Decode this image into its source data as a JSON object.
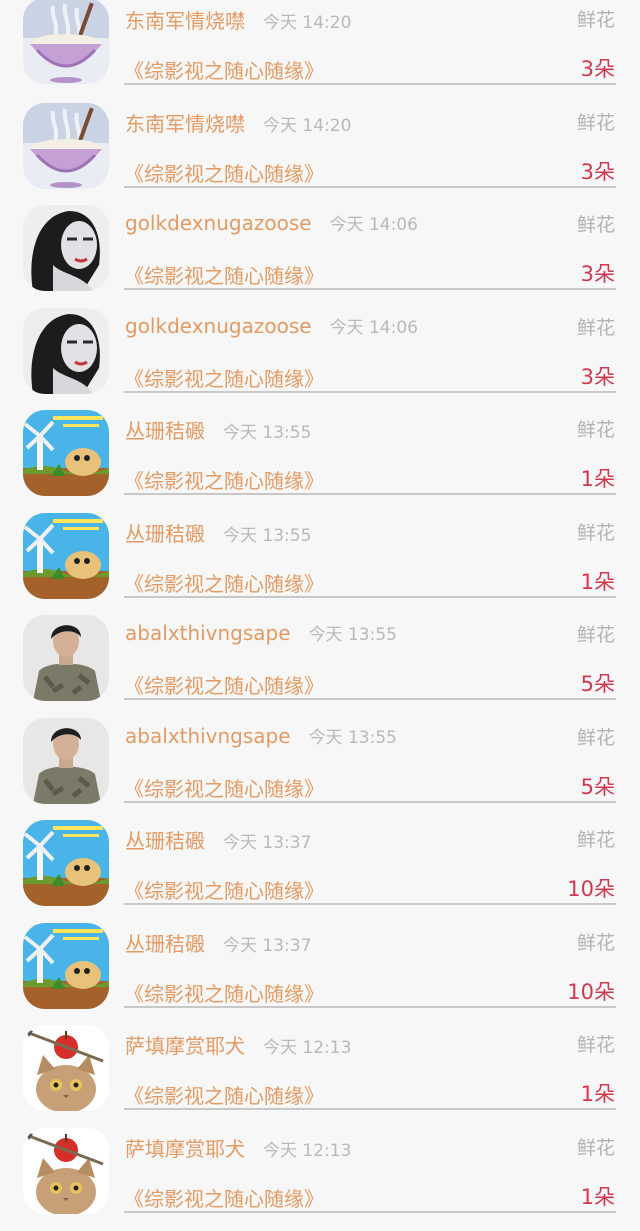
{
  "gifts": [
    {
      "user": "东南军情烧噤",
      "time": "今天 14:20",
      "gift": "鲜花",
      "book": "《综影视之随心随缘》",
      "count": "3朵",
      "avatar": "noodle-bowl"
    },
    {
      "user": "东南军情烧噤",
      "time": "今天 14:20",
      "gift": "鲜花",
      "book": "《综影视之随心随缘》",
      "count": "3朵",
      "avatar": "noodle-bowl"
    },
    {
      "user": "golkdexnugazoose",
      "time": "今天 14:06",
      "gift": "鲜花",
      "book": "《综影视之随心随缘》",
      "count": "3朵",
      "avatar": "woman-portrait"
    },
    {
      "user": "golkdexnugazoose",
      "time": "今天 14:06",
      "gift": "鲜花",
      "book": "《综影视之随心随缘》",
      "count": "3朵",
      "avatar": "woman-portrait"
    },
    {
      "user": "丛珊秸磤",
      "time": "今天 13:55",
      "gift": "鲜花",
      "book": "《综影视之随心随缘》",
      "count": "1朵",
      "avatar": "cartoon-field"
    },
    {
      "user": "丛珊秸磤",
      "time": "今天 13:55",
      "gift": "鲜花",
      "book": "《综影视之随心随缘》",
      "count": "1朵",
      "avatar": "cartoon-field"
    },
    {
      "user": "abalxthivngsape",
      "time": "今天 13:55",
      "gift": "鲜花",
      "book": "《综影视之随心随缘》",
      "count": "5朵",
      "avatar": "man-portrait"
    },
    {
      "user": "abalxthivngsape",
      "time": "今天 13:55",
      "gift": "鲜花",
      "book": "《综影视之随心随缘》",
      "count": "5朵",
      "avatar": "man-portrait"
    },
    {
      "user": "丛珊秸磤",
      "time": "今天 13:37",
      "gift": "鲜花",
      "book": "《综影视之随心随缘》",
      "count": "10朵",
      "avatar": "cartoon-field"
    },
    {
      "user": "丛珊秸磤",
      "time": "今天 13:37",
      "gift": "鲜花",
      "book": "《综影视之随心随缘》",
      "count": "10朵",
      "avatar": "cartoon-field"
    },
    {
      "user": "萨填摩赏耶犬",
      "time": "今天 12:13",
      "gift": "鲜花",
      "book": "《综影视之随心随缘》",
      "count": "1朵",
      "avatar": "cat-apple"
    },
    {
      "user": "萨填摩赏耶犬",
      "time": "今天 12:13",
      "gift": "鲜花",
      "book": "《综影视之随心随缘》",
      "count": "1朵",
      "avatar": "cat-apple"
    }
  ]
}
